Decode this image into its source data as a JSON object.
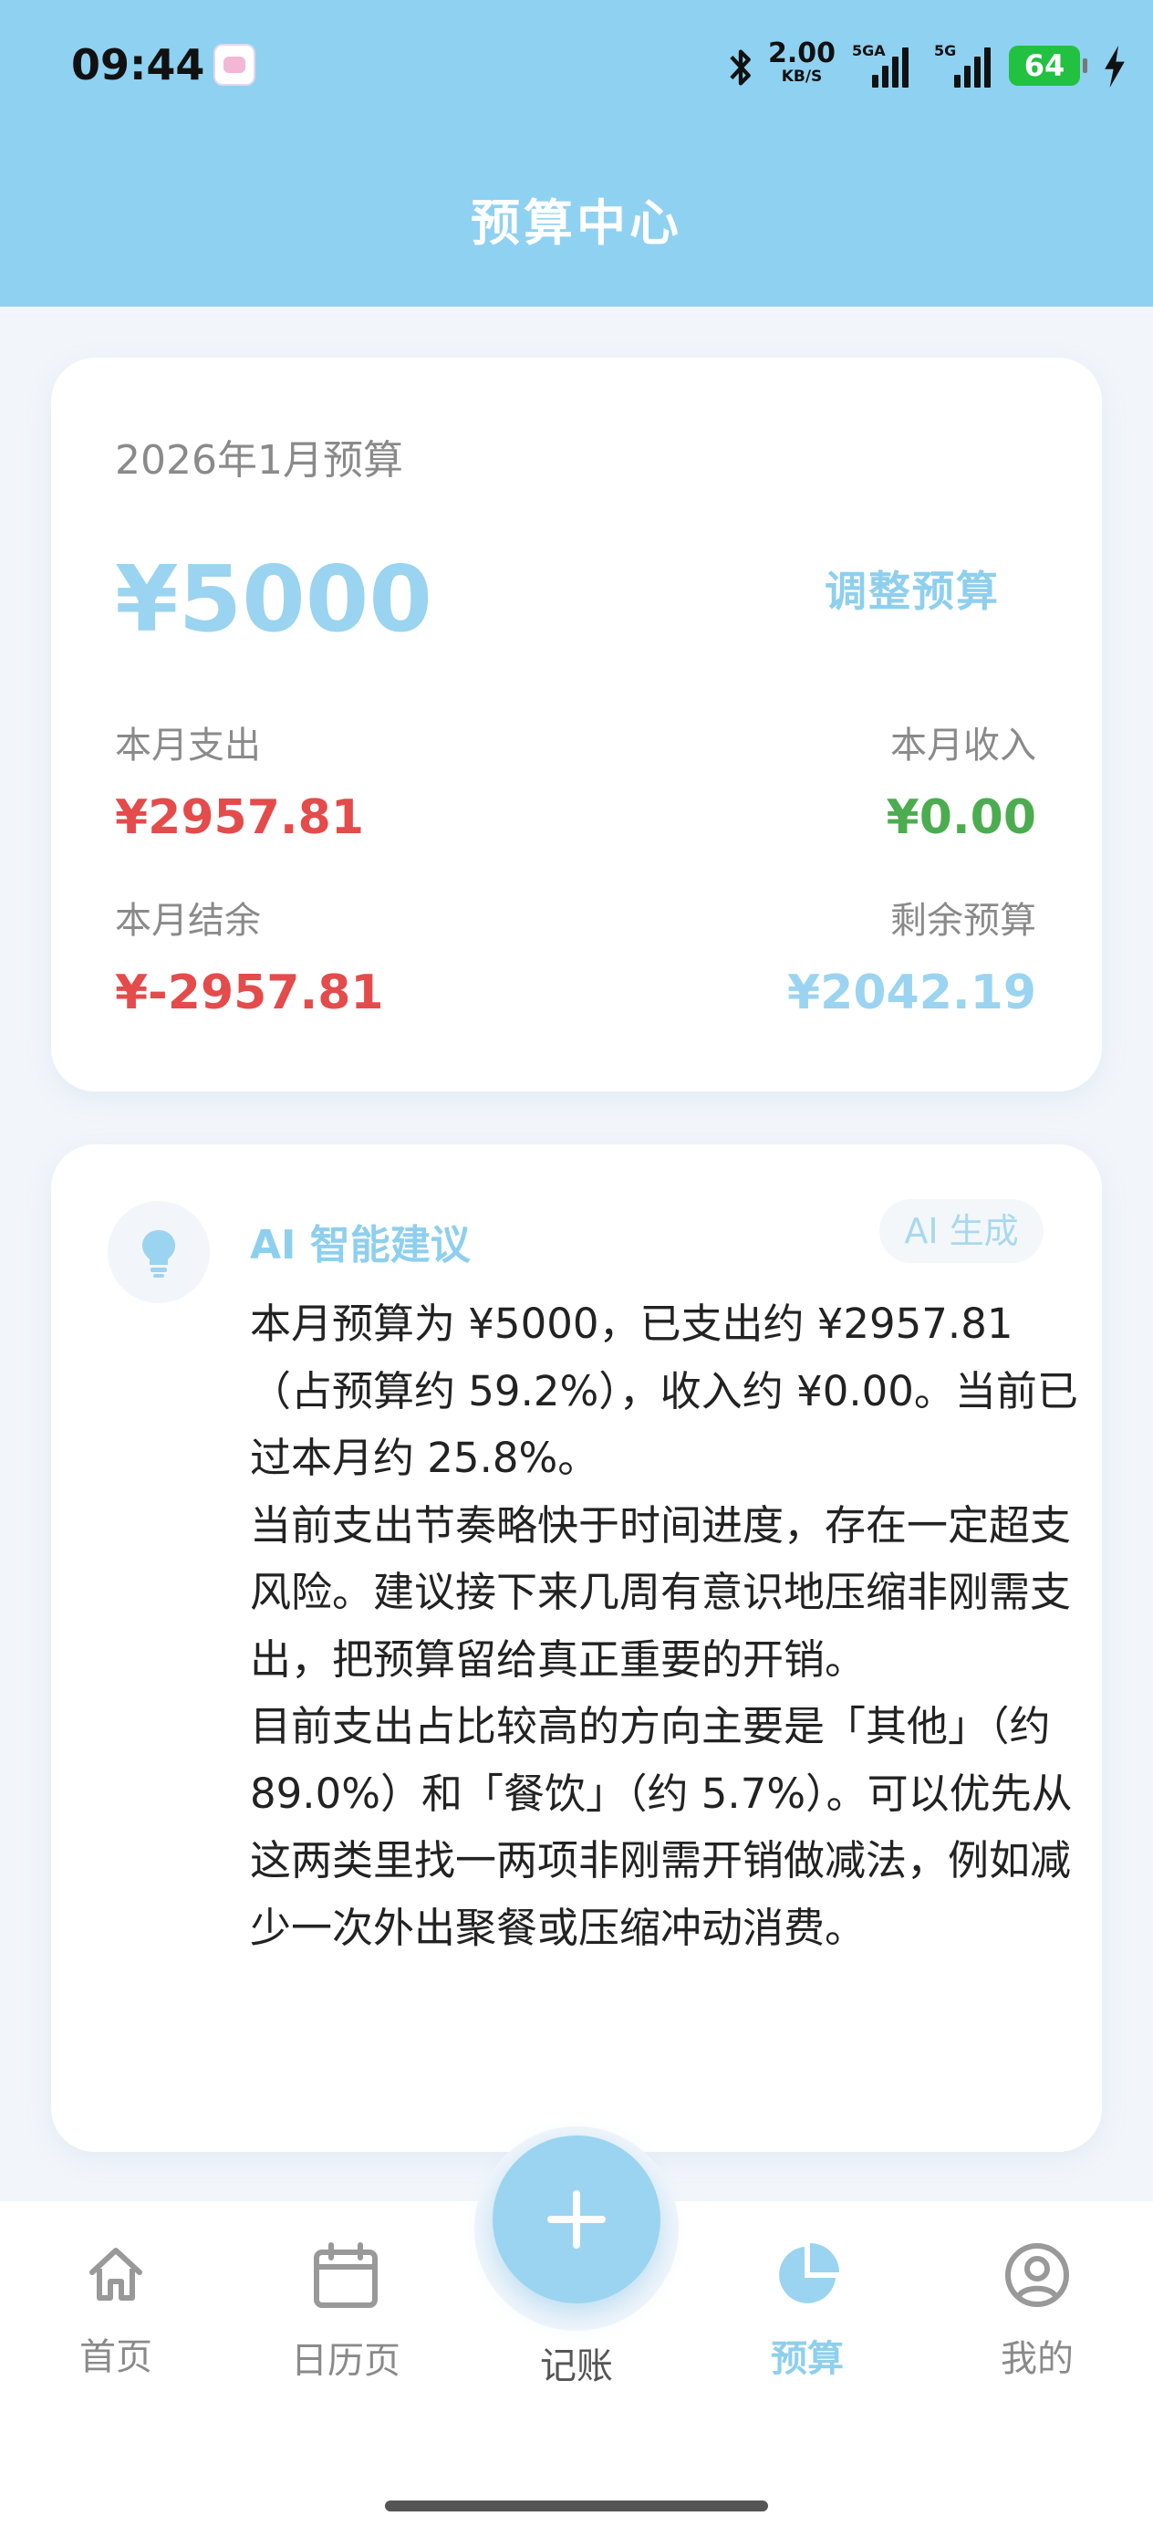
{
  "status_bar": {
    "time": "09:44",
    "net_speed_value": "2.00",
    "net_speed_unit": "KB/S",
    "signal_1": "5GA",
    "signal_2": "5G",
    "battery": "64"
  },
  "header": {
    "title": "预算中心"
  },
  "budget_card": {
    "month_label": "2026年1月预算",
    "amount": "¥5000",
    "adjust_label": "调整预算",
    "expense_label": "本月支出",
    "expense_value": "¥2957.81",
    "income_label": "本月收入",
    "income_value": "¥0.00",
    "balance_label": "本月结余",
    "balance_value": "¥-2957.81",
    "remaining_label": "剩余预算",
    "remaining_value": "¥2042.19"
  },
  "ai_card": {
    "title": "AI 智能建议",
    "tag": "AI 生成",
    "paragraphs": [
      "本月预算为 ¥5000，已支出约 ¥2957.81（占预算约 59.2%），收入约 ¥0.00。当前已过本月约 25.8%。",
      "当前支出节奏略快于时间进度，存在一定超支风险。建议接下来几周有意识地压缩非刚需支出，把预算留给真正重要的开销。",
      "目前支出占比较高的方向主要是「其他」（约 89.0%）和「餐饮」（约 5.7%）。可以优先从这两类里找一两项非刚需开销做减法，例如减少一次外出聚餐或压缩冲动消费。"
    ]
  },
  "tabbar": {
    "home": "首页",
    "calendar": "日历页",
    "record": "记账",
    "budget": "预算",
    "mine": "我的"
  },
  "colors": {
    "header_bg": "#8fd1f1",
    "accent": "#9ad4f0",
    "expense_red": "#e44b4b",
    "income_green": "#4cad50"
  }
}
